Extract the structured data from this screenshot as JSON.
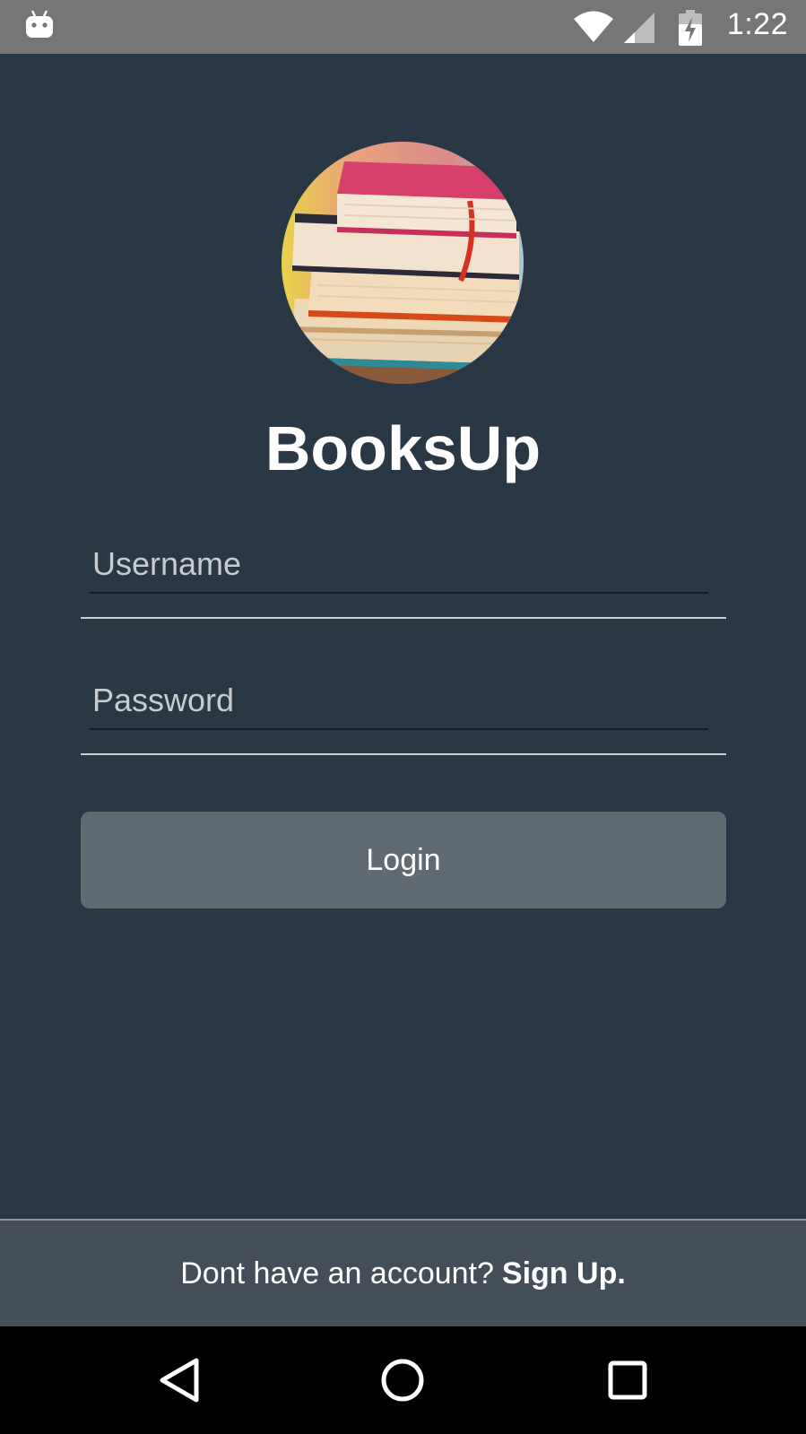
{
  "status_bar": {
    "time": "1:22",
    "icons": [
      "android-icon",
      "wifi-icon",
      "signal-icon",
      "battery-charging-icon"
    ]
  },
  "app": {
    "title": "BooksUp",
    "logo": "stacked-books-image"
  },
  "form": {
    "username_placeholder": "Username",
    "password_placeholder": "Password",
    "login_label": "Login"
  },
  "footer": {
    "prompt": "Dont have an account?",
    "signup_label": "Sign Up."
  },
  "nav_bar": {
    "icons": [
      "back-icon",
      "home-icon",
      "recent-apps-icon"
    ]
  },
  "colors": {
    "background": "#2a3744",
    "status_bar": "#767676",
    "button": "#5f6a73",
    "footer": "#434e58",
    "nav_bar": "#000000"
  }
}
